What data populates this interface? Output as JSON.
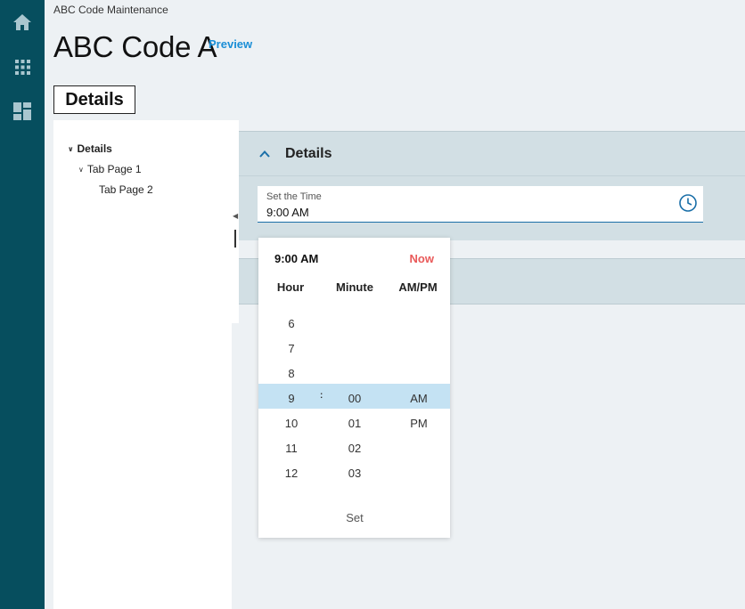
{
  "breadcrumb": "ABC Code Maintenance",
  "page": {
    "title": "ABC Code A",
    "preview_label": "Preview",
    "details_tab": "Details"
  },
  "rail": {
    "icons": [
      "home-icon",
      "apps-grid-icon",
      "dashboard-icon"
    ]
  },
  "tree": {
    "items": [
      {
        "label": "Details"
      },
      {
        "label": "Tab Page 1"
      },
      {
        "label": "Tab Page 2"
      }
    ]
  },
  "section": {
    "title": "Details"
  },
  "time_field": {
    "label": "Set the Time",
    "value": "9:00 AM"
  },
  "picker": {
    "current": "9:00 AM",
    "now_label": "Now",
    "headers": {
      "hour": "Hour",
      "minute": "Minute",
      "ampm": "AM/PM"
    },
    "hours": [
      "6",
      "7",
      "8",
      "9",
      "10",
      "11",
      "12"
    ],
    "minutes": [
      "00",
      "01",
      "02",
      "03"
    ],
    "ampm": [
      "AM",
      "PM"
    ],
    "colon": ":",
    "set_label": "Set"
  },
  "colors": {
    "rail": "#064e5e",
    "accent": "#1a8ed6",
    "now": "#e95a5a",
    "selection": "#c4e2f3",
    "section_bg": "#d2dfe4"
  }
}
